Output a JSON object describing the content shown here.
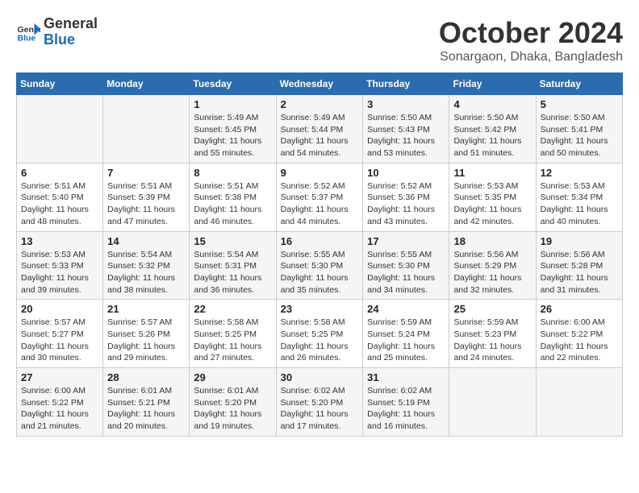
{
  "header": {
    "logo_line1": "General",
    "logo_line2": "Blue",
    "month_title": "October 2024",
    "subtitle": "Sonargaon, Dhaka, Bangladesh"
  },
  "weekdays": [
    "Sunday",
    "Monday",
    "Tuesday",
    "Wednesday",
    "Thursday",
    "Friday",
    "Saturday"
  ],
  "weeks": [
    [
      {
        "day": "",
        "sunrise": "",
        "sunset": "",
        "daylight": ""
      },
      {
        "day": "",
        "sunrise": "",
        "sunset": "",
        "daylight": ""
      },
      {
        "day": "1",
        "sunrise": "Sunrise: 5:49 AM",
        "sunset": "Sunset: 5:45 PM",
        "daylight": "Daylight: 11 hours and 55 minutes."
      },
      {
        "day": "2",
        "sunrise": "Sunrise: 5:49 AM",
        "sunset": "Sunset: 5:44 PM",
        "daylight": "Daylight: 11 hours and 54 minutes."
      },
      {
        "day": "3",
        "sunrise": "Sunrise: 5:50 AM",
        "sunset": "Sunset: 5:43 PM",
        "daylight": "Daylight: 11 hours and 53 minutes."
      },
      {
        "day": "4",
        "sunrise": "Sunrise: 5:50 AM",
        "sunset": "Sunset: 5:42 PM",
        "daylight": "Daylight: 11 hours and 51 minutes."
      },
      {
        "day": "5",
        "sunrise": "Sunrise: 5:50 AM",
        "sunset": "Sunset: 5:41 PM",
        "daylight": "Daylight: 11 hours and 50 minutes."
      }
    ],
    [
      {
        "day": "6",
        "sunrise": "Sunrise: 5:51 AM",
        "sunset": "Sunset: 5:40 PM",
        "daylight": "Daylight: 11 hours and 48 minutes."
      },
      {
        "day": "7",
        "sunrise": "Sunrise: 5:51 AM",
        "sunset": "Sunset: 5:39 PM",
        "daylight": "Daylight: 11 hours and 47 minutes."
      },
      {
        "day": "8",
        "sunrise": "Sunrise: 5:51 AM",
        "sunset": "Sunset: 5:38 PM",
        "daylight": "Daylight: 11 hours and 46 minutes."
      },
      {
        "day": "9",
        "sunrise": "Sunrise: 5:52 AM",
        "sunset": "Sunset: 5:37 PM",
        "daylight": "Daylight: 11 hours and 44 minutes."
      },
      {
        "day": "10",
        "sunrise": "Sunrise: 5:52 AM",
        "sunset": "Sunset: 5:36 PM",
        "daylight": "Daylight: 11 hours and 43 minutes."
      },
      {
        "day": "11",
        "sunrise": "Sunrise: 5:53 AM",
        "sunset": "Sunset: 5:35 PM",
        "daylight": "Daylight: 11 hours and 42 minutes."
      },
      {
        "day": "12",
        "sunrise": "Sunrise: 5:53 AM",
        "sunset": "Sunset: 5:34 PM",
        "daylight": "Daylight: 11 hours and 40 minutes."
      }
    ],
    [
      {
        "day": "13",
        "sunrise": "Sunrise: 5:53 AM",
        "sunset": "Sunset: 5:33 PM",
        "daylight": "Daylight: 11 hours and 39 minutes."
      },
      {
        "day": "14",
        "sunrise": "Sunrise: 5:54 AM",
        "sunset": "Sunset: 5:32 PM",
        "daylight": "Daylight: 11 hours and 38 minutes."
      },
      {
        "day": "15",
        "sunrise": "Sunrise: 5:54 AM",
        "sunset": "Sunset: 5:31 PM",
        "daylight": "Daylight: 11 hours and 36 minutes."
      },
      {
        "day": "16",
        "sunrise": "Sunrise: 5:55 AM",
        "sunset": "Sunset: 5:30 PM",
        "daylight": "Daylight: 11 hours and 35 minutes."
      },
      {
        "day": "17",
        "sunrise": "Sunrise: 5:55 AM",
        "sunset": "Sunset: 5:30 PM",
        "daylight": "Daylight: 11 hours and 34 minutes."
      },
      {
        "day": "18",
        "sunrise": "Sunrise: 5:56 AM",
        "sunset": "Sunset: 5:29 PM",
        "daylight": "Daylight: 11 hours and 32 minutes."
      },
      {
        "day": "19",
        "sunrise": "Sunrise: 5:56 AM",
        "sunset": "Sunset: 5:28 PM",
        "daylight": "Daylight: 11 hours and 31 minutes."
      }
    ],
    [
      {
        "day": "20",
        "sunrise": "Sunrise: 5:57 AM",
        "sunset": "Sunset: 5:27 PM",
        "daylight": "Daylight: 11 hours and 30 minutes."
      },
      {
        "day": "21",
        "sunrise": "Sunrise: 5:57 AM",
        "sunset": "Sunset: 5:26 PM",
        "daylight": "Daylight: 11 hours and 29 minutes."
      },
      {
        "day": "22",
        "sunrise": "Sunrise: 5:58 AM",
        "sunset": "Sunset: 5:25 PM",
        "daylight": "Daylight: 11 hours and 27 minutes."
      },
      {
        "day": "23",
        "sunrise": "Sunrise: 5:58 AM",
        "sunset": "Sunset: 5:25 PM",
        "daylight": "Daylight: 11 hours and 26 minutes."
      },
      {
        "day": "24",
        "sunrise": "Sunrise: 5:59 AM",
        "sunset": "Sunset: 5:24 PM",
        "daylight": "Daylight: 11 hours and 25 minutes."
      },
      {
        "day": "25",
        "sunrise": "Sunrise: 5:59 AM",
        "sunset": "Sunset: 5:23 PM",
        "daylight": "Daylight: 11 hours and 24 minutes."
      },
      {
        "day": "26",
        "sunrise": "Sunrise: 6:00 AM",
        "sunset": "Sunset: 5:22 PM",
        "daylight": "Daylight: 11 hours and 22 minutes."
      }
    ],
    [
      {
        "day": "27",
        "sunrise": "Sunrise: 6:00 AM",
        "sunset": "Sunset: 5:22 PM",
        "daylight": "Daylight: 11 hours and 21 minutes."
      },
      {
        "day": "28",
        "sunrise": "Sunrise: 6:01 AM",
        "sunset": "Sunset: 5:21 PM",
        "daylight": "Daylight: 11 hours and 20 minutes."
      },
      {
        "day": "29",
        "sunrise": "Sunrise: 6:01 AM",
        "sunset": "Sunset: 5:20 PM",
        "daylight": "Daylight: 11 hours and 19 minutes."
      },
      {
        "day": "30",
        "sunrise": "Sunrise: 6:02 AM",
        "sunset": "Sunset: 5:20 PM",
        "daylight": "Daylight: 11 hours and 17 minutes."
      },
      {
        "day": "31",
        "sunrise": "Sunrise: 6:02 AM",
        "sunset": "Sunset: 5:19 PM",
        "daylight": "Daylight: 11 hours and 16 minutes."
      },
      {
        "day": "",
        "sunrise": "",
        "sunset": "",
        "daylight": ""
      },
      {
        "day": "",
        "sunrise": "",
        "sunset": "",
        "daylight": ""
      }
    ]
  ]
}
